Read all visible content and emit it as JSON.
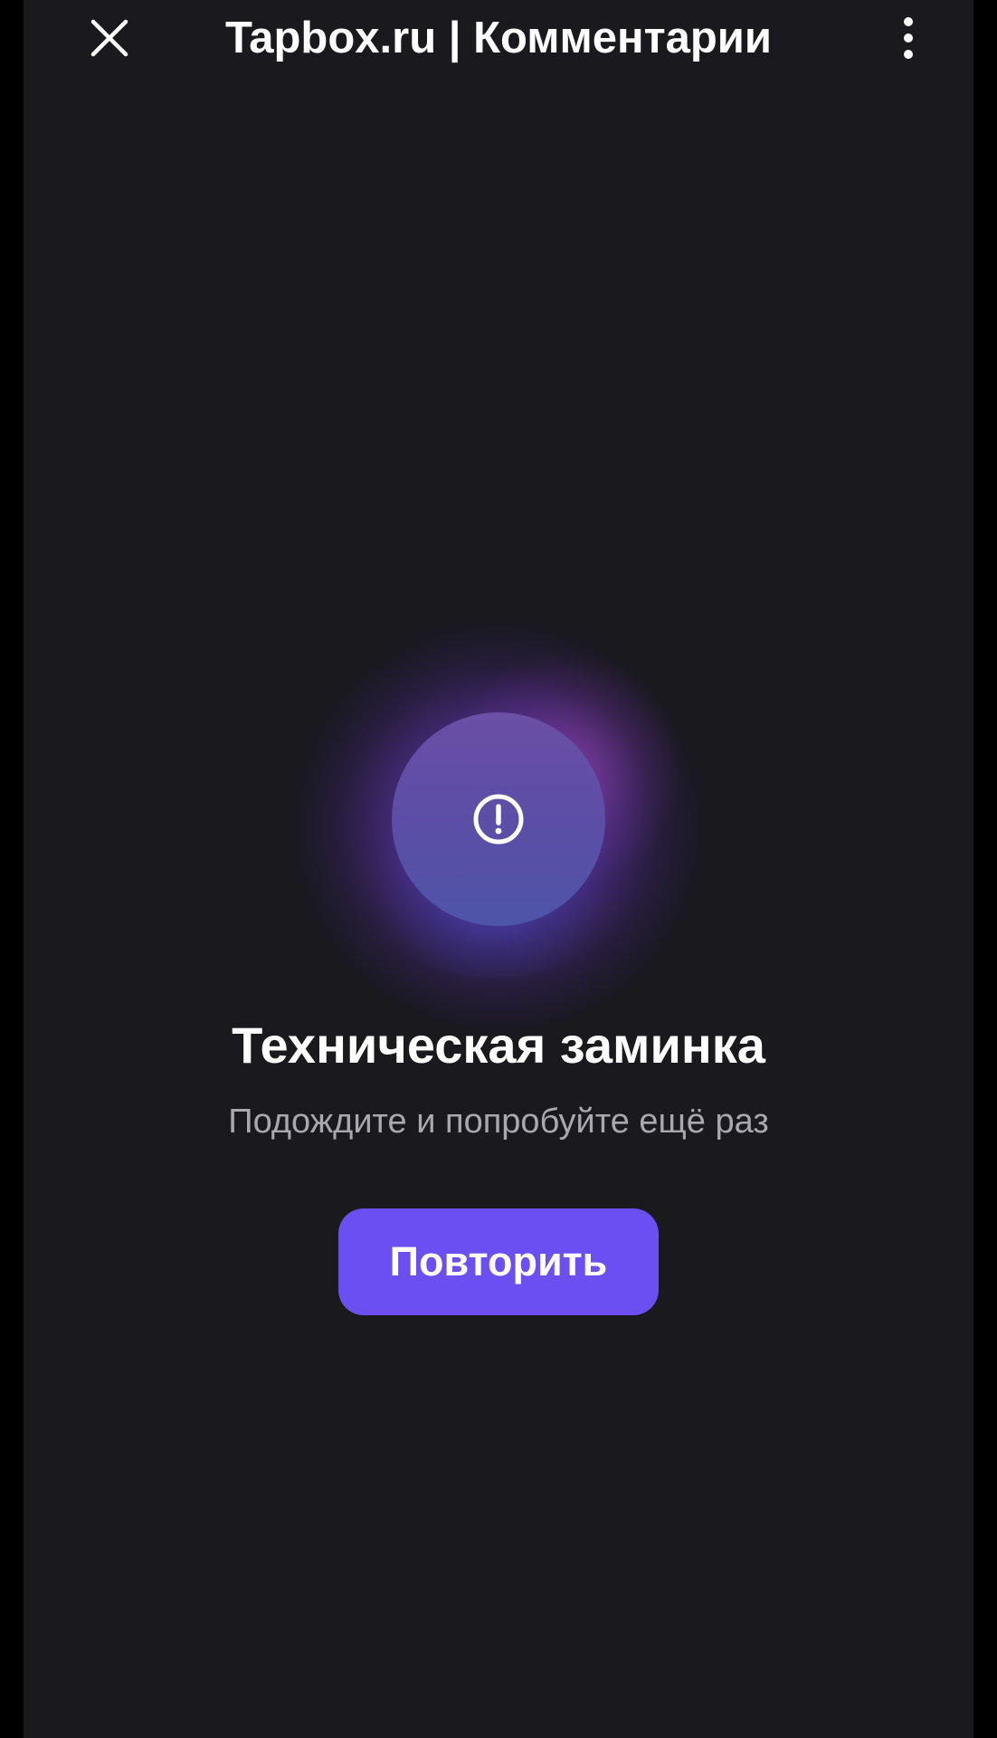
{
  "header": {
    "title": "Tapbox.ru | Комментарии",
    "close_icon": "close-icon",
    "menu_icon": "more-vertical-icon"
  },
  "error": {
    "icon": "alert-circle-icon",
    "title": "Техническая заминка",
    "message": "Подождите и попробуйте ещё раз",
    "retry_label": "Повторить"
  },
  "colors": {
    "background": "#19191e",
    "accent": "#6c4ff0",
    "text_primary": "#ffffff",
    "text_secondary": "#a8a8ae"
  }
}
